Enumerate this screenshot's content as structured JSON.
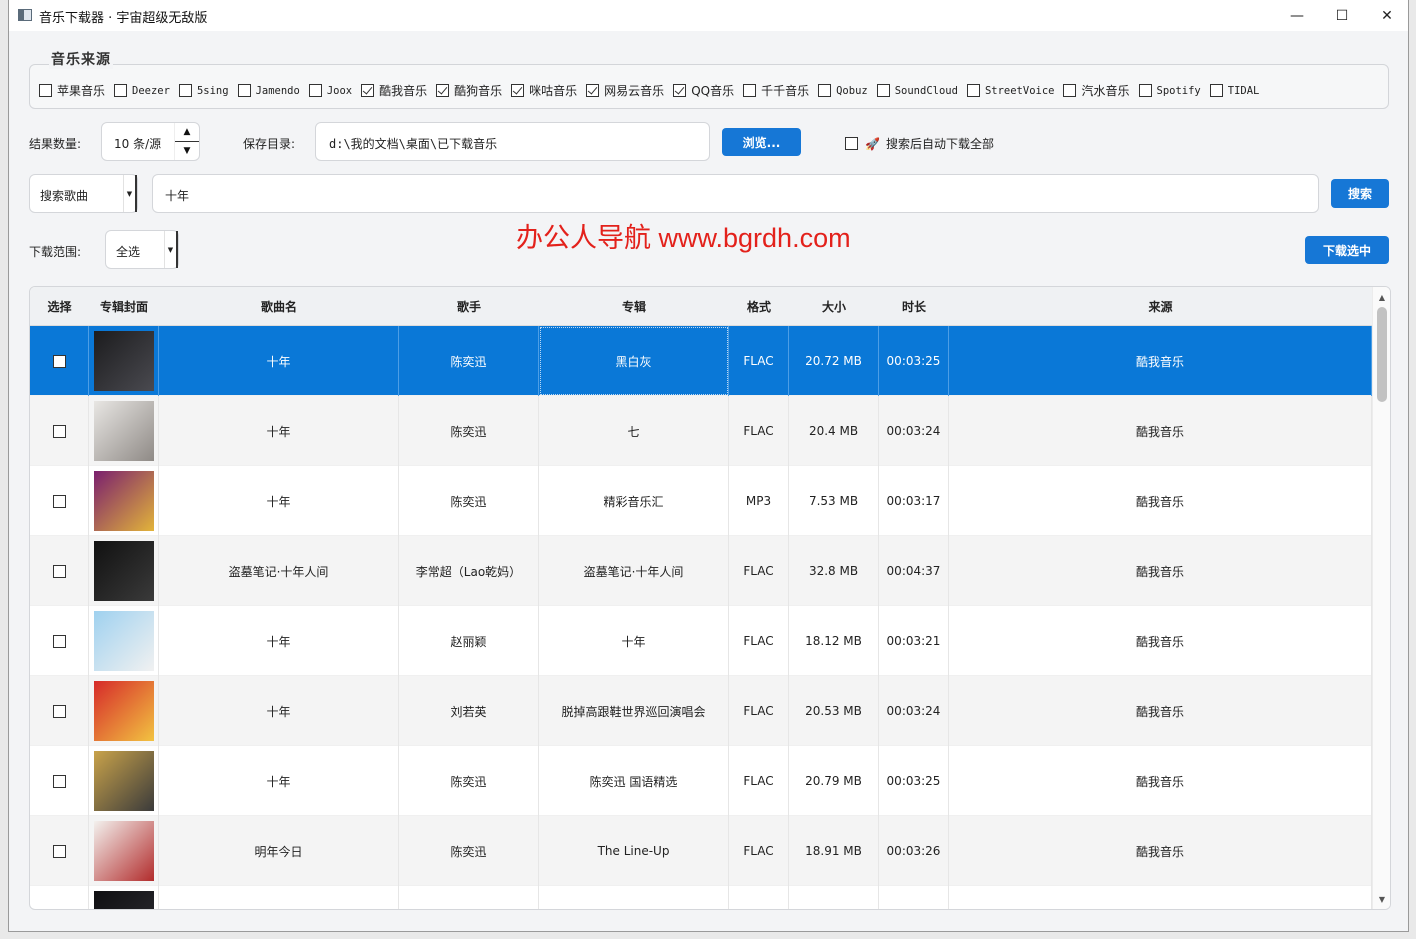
{
  "window": {
    "title": "音乐下载器 · 宇宙超级无敌版",
    "minimize": "—",
    "maximize": "☐",
    "close": "✕"
  },
  "sources": {
    "title": "音乐来源",
    "items": [
      {
        "label": "苹果音乐",
        "checked": false
      },
      {
        "label": "Deezer",
        "checked": false
      },
      {
        "label": "5sing",
        "checked": false
      },
      {
        "label": "Jamendo",
        "checked": false
      },
      {
        "label": "Joox",
        "checked": false
      },
      {
        "label": "酷我音乐",
        "checked": true
      },
      {
        "label": "酷狗音乐",
        "checked": true
      },
      {
        "label": "咪咕音乐",
        "checked": true
      },
      {
        "label": "网易云音乐",
        "checked": true
      },
      {
        "label": "QQ音乐",
        "checked": true
      },
      {
        "label": "千千音乐",
        "checked": false
      },
      {
        "label": "Qobuz",
        "checked": false
      },
      {
        "label": "SoundCloud",
        "checked": false
      },
      {
        "label": "StreetVoice",
        "checked": false
      },
      {
        "label": "汽水音乐",
        "checked": false
      },
      {
        "label": "Spotify",
        "checked": false
      },
      {
        "label": "TIDAL",
        "checked": false
      }
    ]
  },
  "settings": {
    "result_count_label": "结果数量:",
    "result_count_value": "10 条/源",
    "save_dir_label": "保存目录:",
    "save_dir_value": "d:\\我的文档\\桌面\\已下载音乐",
    "browse_label": "浏览...",
    "auto_download_label": "搜索后自动下载全部",
    "auto_download_checked": false
  },
  "search": {
    "mode": "搜索歌曲",
    "query": "十年",
    "button": "搜索"
  },
  "watermark": "办公人导航 www.bgrdh.com",
  "download": {
    "range_label": "下载范围:",
    "range_value": "全选",
    "button": "下载选中"
  },
  "table": {
    "columns": [
      "选择",
      "专辑封面",
      "歌曲名",
      "歌手",
      "专辑",
      "格式",
      "大小",
      "时长",
      "来源"
    ],
    "rows": [
      {
        "title": "十年",
        "artist": "陈奕迅",
        "album": "黑白灰",
        "format": "FLAC",
        "size": "20.72 MB",
        "duration": "00:03:25",
        "source": "酷我音乐",
        "selected": true,
        "cover_colors": [
          "#1c1c1e",
          "#4a4a50"
        ]
      },
      {
        "title": "十年",
        "artist": "陈奕迅",
        "album": "七",
        "format": "FLAC",
        "size": "20.4 MB",
        "duration": "00:03:24",
        "source": "酷我音乐",
        "selected": false,
        "cover_colors": [
          "#e8e6e3",
          "#8f8a86"
        ]
      },
      {
        "title": "十年",
        "artist": "陈奕迅",
        "album": "精彩音乐汇",
        "format": "MP3",
        "size": "7.53 MB",
        "duration": "00:03:17",
        "source": "酷我音乐",
        "selected": false,
        "cover_colors": [
          "#7a1f6e",
          "#e2b43a"
        ]
      },
      {
        "title": "盗墓笔记·十年人间",
        "artist": "李常超（Lao乾妈）",
        "album": "盗墓笔记·十年人间",
        "format": "FLAC",
        "size": "32.8 MB",
        "duration": "00:04:37",
        "source": "酷我音乐",
        "selected": false,
        "cover_colors": [
          "#111111",
          "#3a3a3a"
        ]
      },
      {
        "title": "十年",
        "artist": "赵丽颖",
        "album": "十年",
        "format": "FLAC",
        "size": "18.12 MB",
        "duration": "00:03:21",
        "source": "酷我音乐",
        "selected": false,
        "cover_colors": [
          "#9fd1ef",
          "#f1f1f1"
        ]
      },
      {
        "title": "十年",
        "artist": "刘若英",
        "album": "脱掉高跟鞋世界巡回演唱会",
        "format": "FLAC",
        "size": "20.53 MB",
        "duration": "00:03:24",
        "source": "酷我音乐",
        "selected": false,
        "cover_colors": [
          "#d62a2a",
          "#f2c341"
        ]
      },
      {
        "title": "十年",
        "artist": "陈奕迅",
        "album": "陈奕迅 国语精选",
        "format": "FLAC",
        "size": "20.79 MB",
        "duration": "00:03:25",
        "source": "酷我音乐",
        "selected": false,
        "cover_colors": [
          "#c8a24a",
          "#3b3b3b"
        ]
      },
      {
        "title": "明年今日",
        "artist": "陈奕迅",
        "album": "The Line-Up",
        "format": "FLAC",
        "size": "18.91 MB",
        "duration": "00:03:26",
        "source": "酷我音乐",
        "selected": false,
        "cover_colors": [
          "#f3f1ee",
          "#b22c2c"
        ]
      },
      {
        "title": "",
        "artist": "",
        "album": "",
        "format": "",
        "size": "",
        "duration": "",
        "source": "",
        "selected": false,
        "cover_colors": [
          "#0f0f12",
          "#2d2d33"
        ]
      }
    ]
  },
  "icons": {
    "spin_up": "▲",
    "spin_down": "▼",
    "dropdown": "▼",
    "rocket": "🚀",
    "scroll_up": "▲",
    "scroll_down": "▼"
  }
}
